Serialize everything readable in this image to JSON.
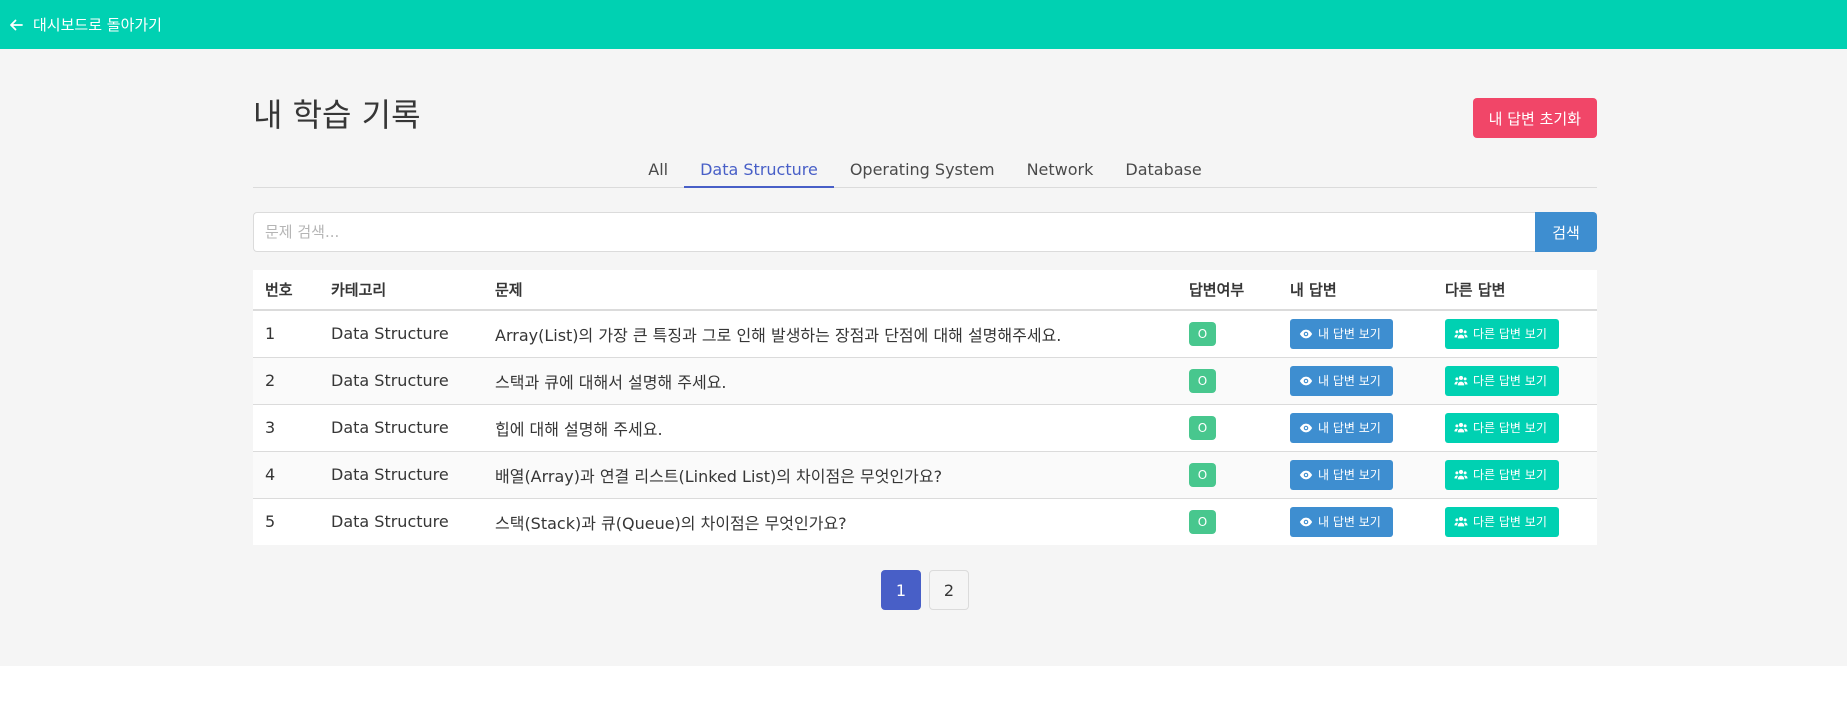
{
  "topbar": {
    "back_label": "대시보드로 돌아가기"
  },
  "page": {
    "title": "내 학습 기록",
    "reset_label": "내 답변 초기화"
  },
  "tabs": [
    {
      "label": "All",
      "active": false
    },
    {
      "label": "Data Structure",
      "active": true
    },
    {
      "label": "Operating System",
      "active": false
    },
    {
      "label": "Network",
      "active": false
    },
    {
      "label": "Database",
      "active": false
    }
  ],
  "search": {
    "placeholder": "문제 검색...",
    "value": "",
    "button_label": "검색"
  },
  "table": {
    "headers": [
      "번호",
      "카테고리",
      "문제",
      "답변여부",
      "내 답변",
      "다른 답변"
    ],
    "rows": [
      {
        "num": "1",
        "category": "Data Structure",
        "question": "Array(List)의 가장 큰 특징과 그로 인해 발생하는 장점과 단점에 대해 설명해주세요.",
        "answered": "O",
        "mine": "내 답변 보기",
        "others": "다른 답변 보기"
      },
      {
        "num": "2",
        "category": "Data Structure",
        "question": "스택과 큐에 대해서 설명해 주세요.",
        "answered": "O",
        "mine": "내 답변 보기",
        "others": "다른 답변 보기"
      },
      {
        "num": "3",
        "category": "Data Structure",
        "question": "힙에 대해 설명해 주세요.",
        "answered": "O",
        "mine": "내 답변 보기",
        "others": "다른 답변 보기"
      },
      {
        "num": "4",
        "category": "Data Structure",
        "question": "배열(Array)과 연결 리스트(Linked List)의 차이점은 무엇인가요?",
        "answered": "O",
        "mine": "내 답변 보기",
        "others": "다른 답변 보기"
      },
      {
        "num": "5",
        "category": "Data Structure",
        "question": "스택(Stack)과 큐(Queue)의 차이점은 무엇인가요?",
        "answered": "O",
        "mine": "내 답변 보기",
        "others": "다른 답변 보기"
      }
    ]
  },
  "pagination": {
    "pages": [
      "1",
      "2"
    ],
    "current": "1"
  },
  "colors": {
    "primary": "#00d1b2",
    "danger": "#f14668",
    "info": "#3e8ed0",
    "success": "#48c78e",
    "link": "#485fc7"
  },
  "icons": {
    "back": "arrow-left-icon",
    "mine": "eye-icon",
    "others": "users-icon"
  }
}
